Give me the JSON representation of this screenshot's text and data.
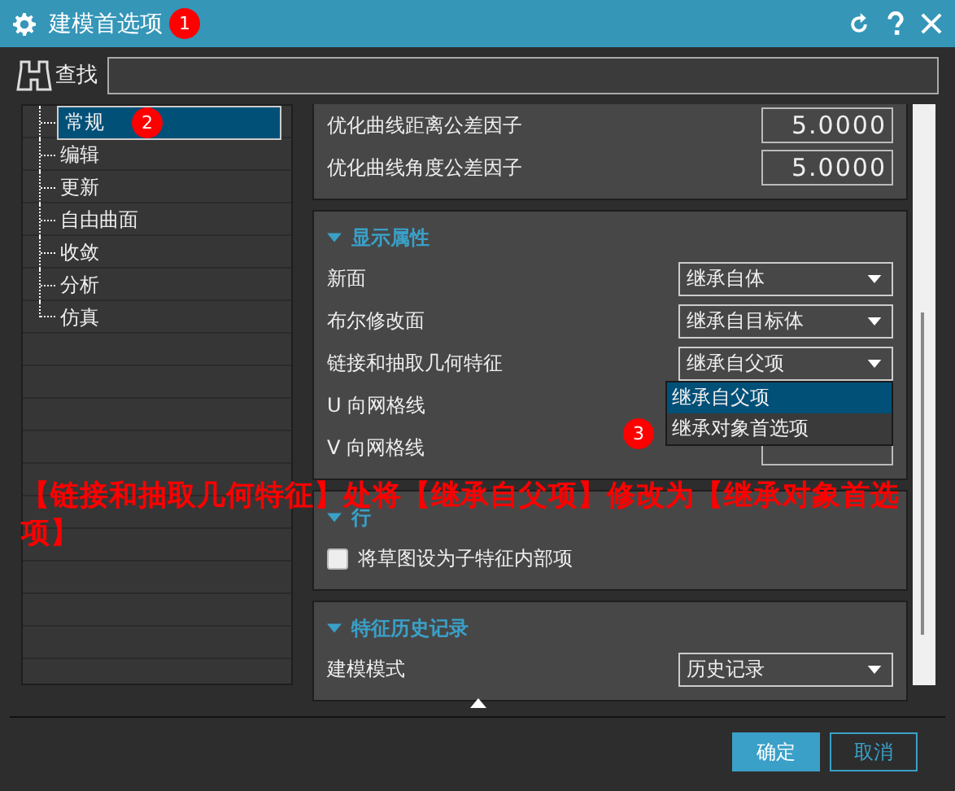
{
  "window": {
    "title": "建模首选项",
    "badge": "1"
  },
  "search": {
    "label": "查找"
  },
  "tree": {
    "items": [
      {
        "label": "常规",
        "selected": true,
        "badge": "2"
      },
      {
        "label": "编辑",
        "selected": false
      },
      {
        "label": "更新",
        "selected": false
      },
      {
        "label": "自由曲面",
        "selected": false
      },
      {
        "label": "收敛",
        "selected": false
      },
      {
        "label": "分析",
        "selected": false
      },
      {
        "label": "仿真",
        "selected": false
      }
    ]
  },
  "groups": [
    {
      "rows": [
        {
          "kind": "number",
          "label": "优化曲线距离公差因子",
          "value": "5.0000"
        },
        {
          "kind": "number",
          "label": "优化曲线角度公差因子",
          "value": "5.0000"
        }
      ]
    },
    {
      "title": "显示属性",
      "expanded": true,
      "rows": [
        {
          "kind": "select",
          "label": "新面",
          "value": "继承自体"
        },
        {
          "kind": "select",
          "label": "布尔修改面",
          "value": "继承自目标体"
        },
        {
          "kind": "select",
          "label": "链接和抽取几何特征",
          "value": "继承自父项",
          "open": true,
          "options": [
            {
              "label": "继承自父项",
              "selected": true
            },
            {
              "label": "继承对象首选项",
              "selected": false,
              "badge": "3"
            }
          ]
        },
        {
          "kind": "hidden",
          "label": "U 向网格线"
        },
        {
          "kind": "number",
          "label": "V 向网格线"
        }
      ]
    },
    {
      "title": "行",
      "expanded": true,
      "rows": [
        {
          "kind": "checkbox",
          "label": "将草图设为子特征内部项",
          "checked": false
        }
      ]
    },
    {
      "title": "特征历史记录",
      "expanded": true,
      "rows": [
        {
          "kind": "select",
          "label": "建模模式",
          "value": "历史记录"
        }
      ]
    }
  ],
  "annotation": "【链接和抽取几何特征】处将【继承自父项】修改为【继承对象首选项】",
  "buttons": [
    {
      "label": "确定",
      "kind": "primary"
    },
    {
      "label": "取消",
      "kind": "secondary"
    }
  ]
}
